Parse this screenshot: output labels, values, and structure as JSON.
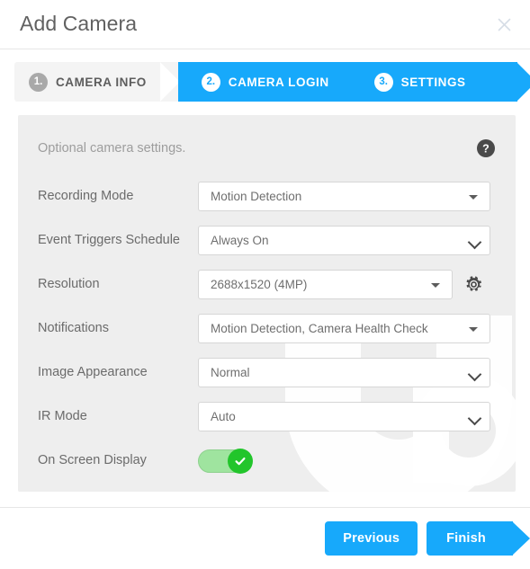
{
  "dialog": {
    "title": "Add Camera",
    "close_label": "×",
    "close_icon": "close-icon"
  },
  "steps": [
    {
      "number": "1.",
      "label": "CAMERA INFO",
      "active": false
    },
    {
      "number": "2.",
      "label": "CAMERA LOGIN",
      "active": true
    },
    {
      "number": "3.",
      "label": "SETTINGS",
      "active": true
    }
  ],
  "panel": {
    "hint": "Optional camera settings.",
    "help_icon": "help-circle-icon",
    "fields": [
      {
        "label": "Recording Mode",
        "value": "Motion Detection",
        "control": "dropdown",
        "caret": "triangle-down-icon"
      },
      {
        "label": "Event Triggers Schedule",
        "value": "Always On",
        "control": "select",
        "caret": "chevron-down-icon"
      },
      {
        "label": "Resolution",
        "value": "2688x1520 (4MP)",
        "control": "dropdown",
        "caret": "triangle-down-icon",
        "extra_icon": "gear-icon"
      },
      {
        "label": "Notifications",
        "value": "Motion Detection, Camera Health Check",
        "control": "dropdown",
        "caret": "triangle-down-icon"
      },
      {
        "label": "Image Appearance",
        "value": "Normal",
        "control": "select",
        "caret": "chevron-down-icon"
      },
      {
        "label": "IR Mode",
        "value": "Auto",
        "control": "select",
        "caret": "chevron-down-icon"
      },
      {
        "label": "On Screen Display",
        "value": "On",
        "control": "toggle",
        "toggle_on": true,
        "knob_icon": "check-icon"
      }
    ]
  },
  "footer": {
    "previous_label": "Previous",
    "finish_label": "Finish"
  },
  "colors": {
    "accent": "#17a9fb",
    "panel_bg": "#eeeeee",
    "toggle_track": "#9fe49f",
    "toggle_knob": "#22c52b",
    "inactive_step_bg": "#f4f4f4",
    "inactive_badge": "#a9a9a9"
  }
}
